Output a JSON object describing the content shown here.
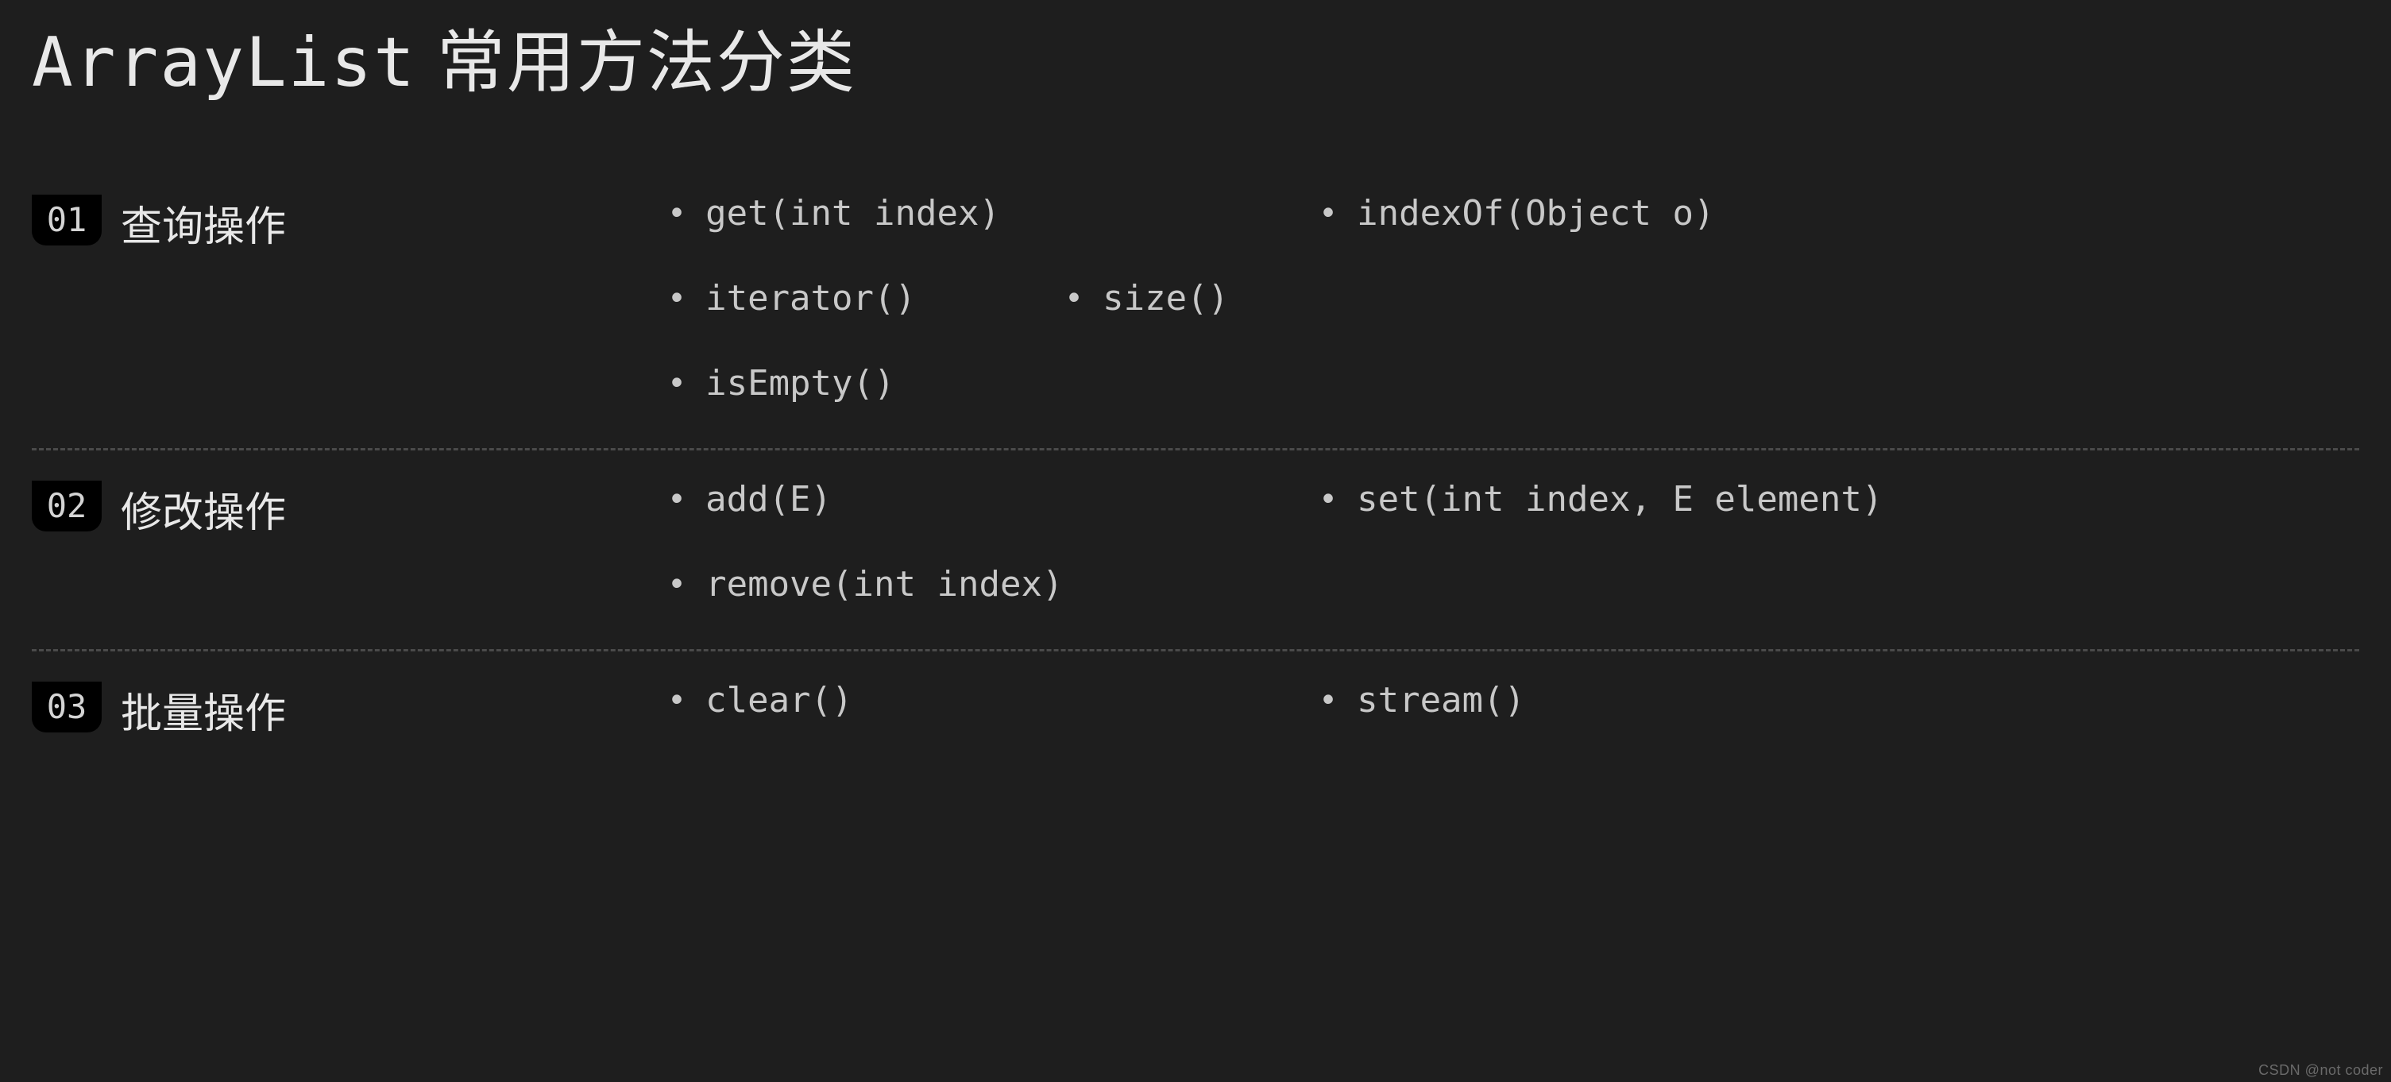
{
  "title_prefix": "ArrayList",
  "title_suffix": "常用方法分类",
  "sections": [
    {
      "num": "01",
      "label": "查询操作",
      "methods": [
        {
          "text": "get(int index)",
          "col": "a"
        },
        {
          "text": "indexOf(Object o)",
          "col": "b"
        },
        {
          "text": "iterator()",
          "col": "c"
        },
        {
          "text": "size()",
          "col": "a"
        },
        {
          "text": "isEmpty()",
          "col": "b"
        }
      ]
    },
    {
      "num": "02",
      "label": "修改操作",
      "methods": [
        {
          "text": "add(E)",
          "col": "a"
        },
        {
          "text": "set(int index, E element)",
          "col": "b"
        },
        {
          "text": "remove(int index)",
          "col": "a"
        }
      ]
    },
    {
      "num": "03",
      "label": "批量操作",
      "methods": [
        {
          "text": "clear()",
          "col": "a"
        },
        {
          "text": "stream()",
          "col": "b"
        }
      ]
    }
  ],
  "watermark": "CSDN @not coder"
}
